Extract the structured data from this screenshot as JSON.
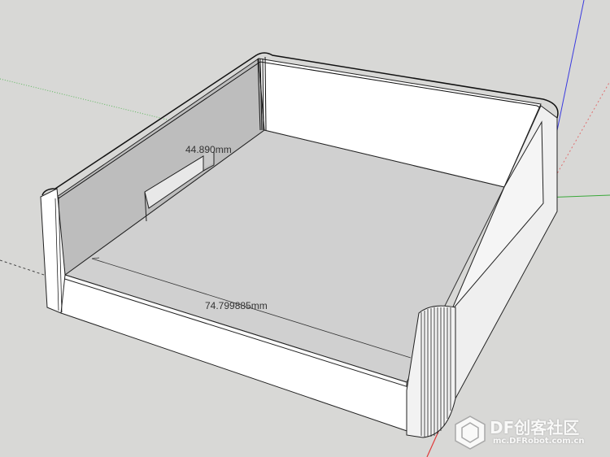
{
  "viewport": {
    "background": "#d8d8d6",
    "axes": {
      "red": "#e03a3a",
      "green": "#3aa83a",
      "blue": "#3a3ae0"
    }
  },
  "model": {
    "dimensions": [
      {
        "label": "44.890mm"
      },
      {
        "label": "74.799885mm"
      }
    ]
  },
  "watermark": {
    "brand": "DF创客社区",
    "url": "mc.DFRobot.com.cn"
  }
}
